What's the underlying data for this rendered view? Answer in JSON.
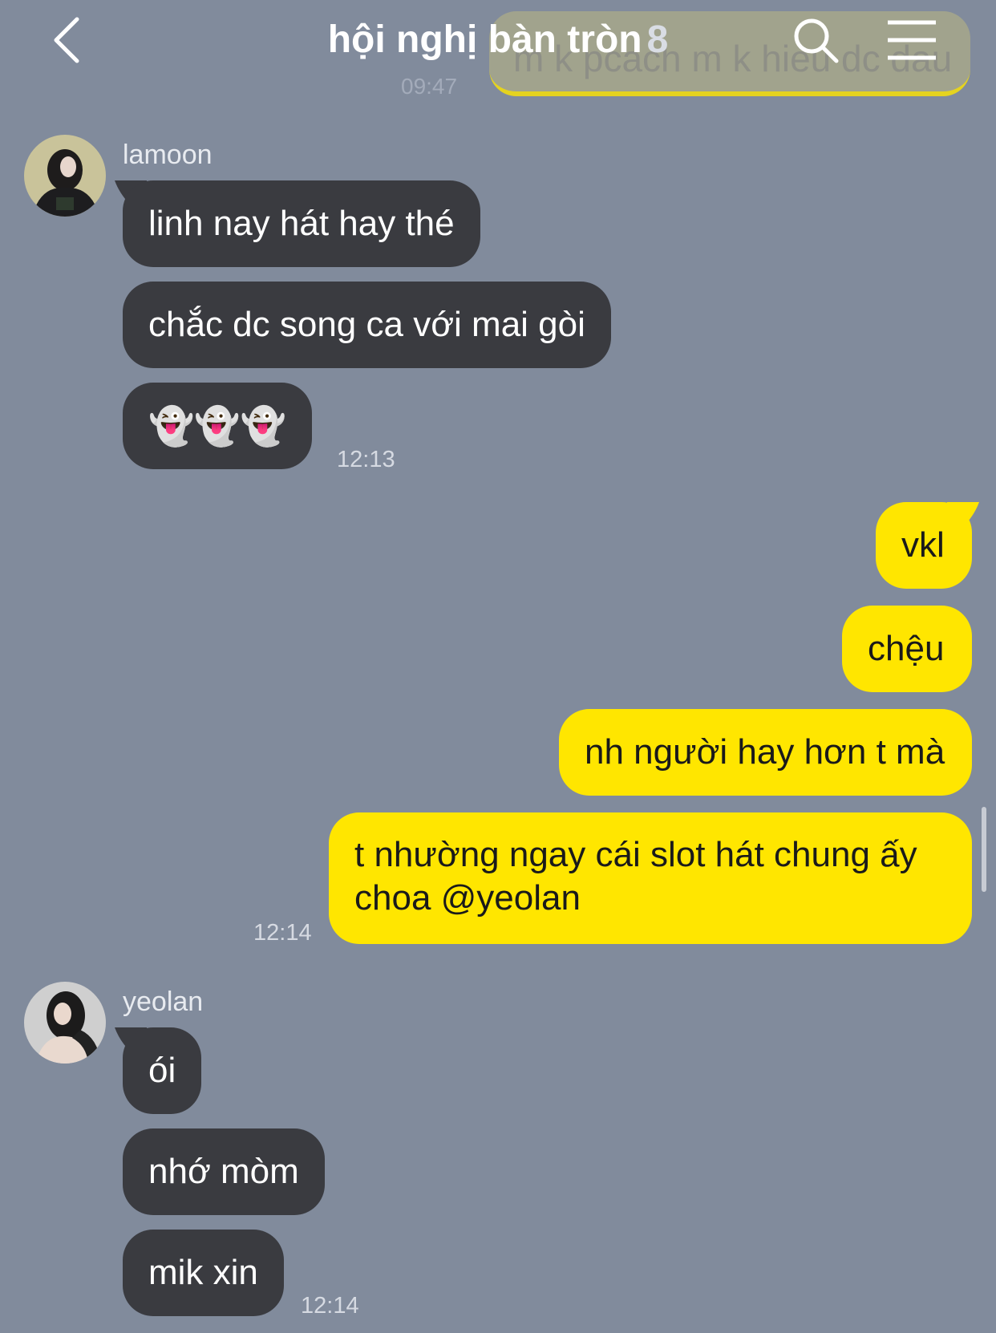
{
  "header": {
    "title": "hội nghị bàn tròn",
    "member_count": "8",
    "back_icon": "chevron-left-icon",
    "search_icon": "search-icon",
    "menu_icon": "hamburger-menu-icon"
  },
  "prev_message": {
    "text": "m k pcach m k hieu dc dau",
    "time": "09:47"
  },
  "groups": [
    {
      "sender": "lamoon",
      "messages": [
        "linh nay hát hay thé",
        "chắc dc song ca với mai gòi",
        "👻👻👻"
      ],
      "time": "12:13"
    },
    {
      "sender": "me",
      "messages": [
        "vkl",
        "chệu",
        "nh người hay hơn t mà",
        "t nhường ngay cái slot hát chung ấy choa @yeolan"
      ],
      "time": "12:14"
    },
    {
      "sender": "yeolan",
      "messages": [
        "ói",
        "nhớ mòm",
        "mik xin"
      ],
      "time": "12:14"
    }
  ],
  "colors": {
    "background": "#818b9c",
    "incoming_bubble": "#3a3b40",
    "outgoing_bubble": "#ffe600"
  }
}
